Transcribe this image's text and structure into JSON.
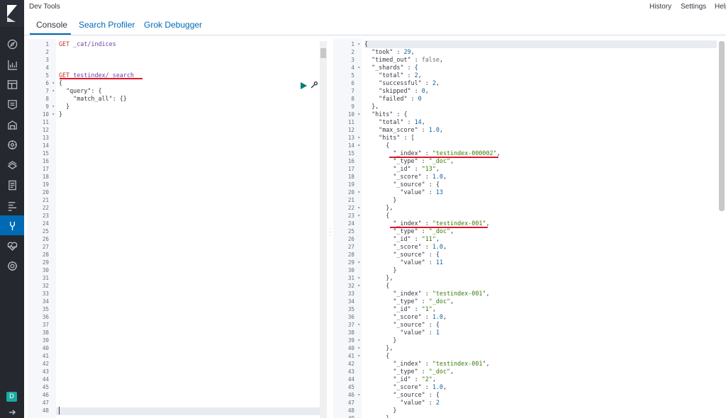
{
  "app": {
    "title": "Dev Tools"
  },
  "header": {
    "links": [
      "History",
      "Settings",
      "Help"
    ]
  },
  "tabs": [
    {
      "label": "Console",
      "selected": true
    },
    {
      "label": "Search Profiler",
      "selected": false
    },
    {
      "label": "Grok Debugger",
      "selected": false
    }
  ],
  "nav": {
    "icons": [
      "kibana-logo",
      "discover-icon",
      "visualize-icon",
      "dashboard-icon",
      "canvas-icon",
      "maps-icon",
      "machine-learning-icon",
      "infrastructure-icon",
      "logs-icon",
      "apm-icon",
      "dev-tools-icon",
      "monitoring-icon",
      "management-icon"
    ],
    "active": "dev-tools-icon",
    "user_initial": "D",
    "accent_color": "#006bb4",
    "badge_color": "#1ba9a0"
  },
  "request": {
    "line_count": 48,
    "fold_lines": [
      6,
      7,
      9,
      10
    ],
    "lines": [
      {
        "n": 1,
        "text": "GET _cat/indices"
      },
      {
        "n": 2,
        "text": ""
      },
      {
        "n": 3,
        "text": ""
      },
      {
        "n": 4,
        "text": ""
      },
      {
        "n": 5,
        "text": "GET testindex/_search"
      },
      {
        "n": 6,
        "text": "{"
      },
      {
        "n": 7,
        "text": "  \"query\": {"
      },
      {
        "n": 8,
        "text": "    \"match_all\": {}"
      },
      {
        "n": 9,
        "text": "  }"
      },
      {
        "n": 10,
        "text": "}"
      }
    ]
  },
  "response": {
    "fold_lines": [
      1,
      4,
      10,
      13,
      14,
      20,
      22,
      23,
      29,
      31,
      32,
      37,
      39,
      40,
      41,
      46
    ],
    "lines": [
      "{",
      "  \"took\" : 29,",
      "  \"timed_out\" : false,",
      "  \"_shards\" : {",
      "    \"total\" : 2,",
      "    \"successful\" : 2,",
      "    \"skipped\" : 0,",
      "    \"failed\" : 0",
      "  },",
      "  \"hits\" : {",
      "    \"total\" : 14,",
      "    \"max_score\" : 1.0,",
      "    \"hits\" : [",
      "      {",
      "        \"_index\" : \"testindex-000002\",",
      "        \"_type\" : \"_doc\",",
      "        \"_id\" : \"13\",",
      "        \"_score\" : 1.0,",
      "        \"_source\" : {",
      "          \"value\" : 13",
      "        }",
      "      },",
      "      {",
      "        \"_index\" : \"testindex-001\",",
      "        \"_type\" : \"_doc\",",
      "        \"_id\" : \"11\",",
      "        \"_score\" : 1.0,",
      "        \"_source\" : {",
      "          \"value\" : 11",
      "        }",
      "      },",
      "      {",
      "        \"_index\" : \"testindex-001\",",
      "        \"_type\" : \"_doc\",",
      "        \"_id\" : \"1\",",
      "        \"_score\" : 1.0,",
      "        \"_source\" : {",
      "          \"value\" : 1",
      "        }",
      "      },",
      "      {",
      "        \"_index\" : \"testindex-001\",",
      "        \"_type\" : \"_doc\",",
      "        \"_id\" : \"2\",",
      "        \"_score\" : 1.0,",
      "        \"_source\" : {",
      "          \"value\" : 2",
      "        }",
      "      },"
    ]
  }
}
